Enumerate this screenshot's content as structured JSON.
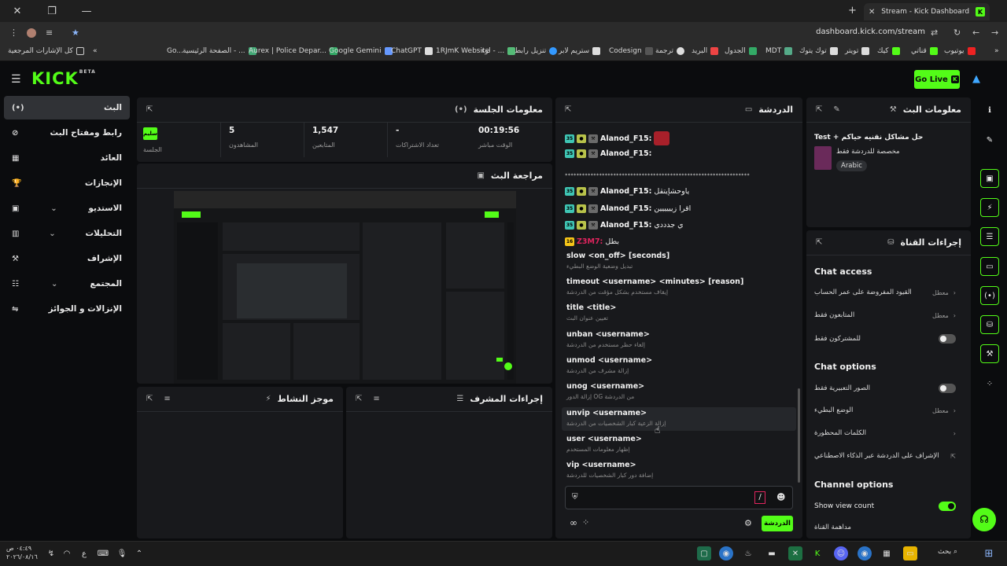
{
  "browser": {
    "tab_title": "Stream - Kick Dashboard",
    "url": "dashboard.kick.com/stream",
    "bookmarks": [
      "يوتيوب",
      "قناتي",
      "كيك",
      "تويتر",
      "توك يتوك",
      "MDT",
      "الجدول",
      "البريد",
      "ترجمة",
      "Codesign",
      "ستريم لابر",
      "تنزيل رابط",
      "لوء - ...",
      "1RJmK Website",
      "ChatGPT",
      "Google Gemini",
      "Aurex | Police Depar...",
      "الصفحة الرئيسية - ...",
      "Go...",
      "كل الإشارات المرجعية"
    ]
  },
  "app": {
    "logo": "KICK",
    "logo_sup": "BETA",
    "go_live": "Go Live"
  },
  "nav": [
    {
      "label": "البث",
      "icon": "(•)",
      "active": true
    },
    {
      "label": "رابط ومفتاح البث",
      "icon": "⊘"
    },
    {
      "label": "العائد",
      "icon": "▦"
    },
    {
      "label": "الإنجازات",
      "icon": "🏆"
    },
    {
      "label": "الاستديو",
      "icon": "▣",
      "chevron": "⌄"
    },
    {
      "label": "التحليلات",
      "icon": "▥",
      "chevron": "⌄"
    },
    {
      "label": "الإشراف",
      "icon": "⚒"
    },
    {
      "label": "المجتمع",
      "icon": "☷",
      "chevron": "⌄"
    },
    {
      "label": "الإنزالات و الجوائز",
      "icon": "⇋"
    }
  ],
  "session": {
    "title": "معلومات الجلسة",
    "stats": [
      {
        "value": "00:19:56",
        "label": "الوقت مباشر"
      },
      {
        "value": "-",
        "label": "تعداد الاشتراكات"
      },
      {
        "value": "1,547",
        "label": "المتابعين"
      },
      {
        "value": "5",
        "label": "المشاهدون"
      }
    ],
    "badge": "سليم",
    "badge_label": "الجلسة"
  },
  "preview": {
    "title": "مراجعة البث"
  },
  "activity": {
    "title": "موجز النشاط"
  },
  "modactions": {
    "title": "إجراءات المشرف"
  },
  "chat": {
    "title": "الدردشة",
    "messages": [
      {
        "user": "Alanod_F15:",
        "text": ""
      },
      {
        "user": "Alanod_F15:",
        "text": ""
      },
      {
        "user": "",
        "text": "*****************************************************************"
      },
      {
        "user": "Alanod_F15:",
        "text": "ياوحش‏إيتقل"
      },
      {
        "user": "Alanod_F15:",
        "text": "اقرا زيييييين"
      },
      {
        "user": "Alanod_F15:",
        "text": "ي جدددي"
      },
      {
        "user": "Z3M7:",
        "text": "بطل",
        "level": "16"
      }
    ],
    "commands": [
      {
        "cmd": "slow <on_off> [seconds]",
        "desc": "تبديل وضعية الوضع البطيء"
      },
      {
        "cmd": "timeout <username> <minutes> [reason]",
        "desc": "إيقاف مستخدم بشكل مؤقت من الدردشة"
      },
      {
        "cmd": "title <title>",
        "desc": "تعيين عنوان البث"
      },
      {
        "cmd": "unban <username>",
        "desc": "إلغاء حظر مستخدم من الدردشة"
      },
      {
        "cmd": "unmod <username>",
        "desc": "إزالة مشرف من الدردشة"
      },
      {
        "cmd": "unog <username>",
        "desc": "من الدردشة OG إزالة الدور"
      },
      {
        "cmd": "unvip <username>",
        "desc": "إزالة الزعية كبار الشخصيات من الدردشة"
      },
      {
        "cmd": "user <username>",
        "desc": "إظهار معلومات المستخدم"
      },
      {
        "cmd": "vip <username>",
        "desc": "إضافة دور كبار الشخصيات للدردشة"
      }
    ],
    "input_value": "/",
    "send_label": "الدردشة"
  },
  "streaminfo": {
    "title": "معلومات البث",
    "stream_title": "حل مشاكل نقنيه حياكم + Test",
    "sub": "مخصصة للدردشة فقط",
    "tag": "Arabic"
  },
  "channel": {
    "title": "إجراءات القناة",
    "chat_access": "Chat access",
    "access_rows": [
      {
        "label": "القيود المفروضة على عمر الحساب",
        "value": "معطل"
      },
      {
        "label": "المتابعون فقط",
        "value": "معطل"
      },
      {
        "label": "للمشتركون فقط",
        "value": ""
      }
    ],
    "chat_options": "Chat options",
    "option_rows": [
      {
        "label": "الصور التعبيرية فقط",
        "value": ""
      },
      {
        "label": "الوضع البطيء",
        "value": "معطل"
      },
      {
        "label": "الكلمات المحظورة",
        "value": ""
      },
      {
        "label": "الإشراف على الدردشة عبر الذكاء الاصطناعي",
        "value": ""
      }
    ],
    "channel_options": "Channel options",
    "show_view_count": "Show view count",
    "host_label": "مداهمة القناة"
  },
  "taskbar": {
    "time": "٠٤:٤٩ ص",
    "date": "٢٠٢٦/٠٨/١٦",
    "search": "بحث"
  }
}
